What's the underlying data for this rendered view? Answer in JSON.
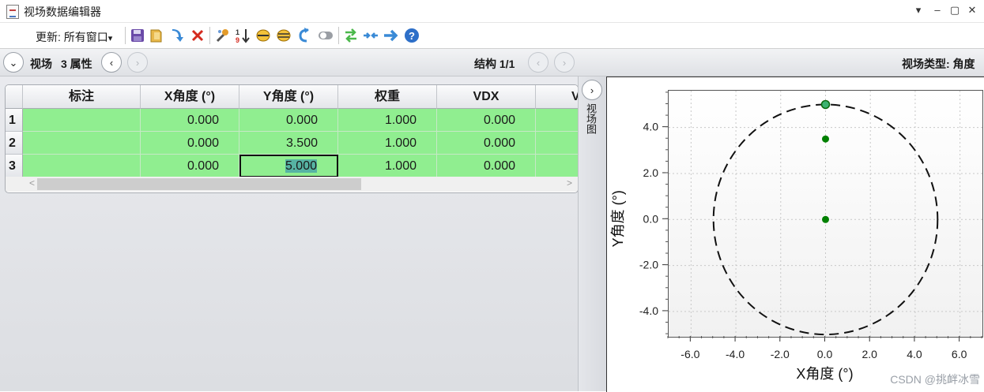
{
  "window": {
    "title": "视场数据编辑器",
    "controls": [
      "▾",
      "–",
      "▢",
      "✕"
    ]
  },
  "toolbar": {
    "update_label": "更新: 所有窗口",
    "update_arrow": "▾",
    "icons": [
      "save-icon",
      "open-icon",
      "import-icon",
      "delete-icon",
      "tool-icon",
      "sort-icon",
      "ellipse-icon",
      "ellipse-fill-icon",
      "reverse-icon",
      "toggle-icon",
      "swap-icon",
      "join-icon",
      "arrow-right-icon",
      "help-icon"
    ]
  },
  "nav": {
    "expand_symbol": "⌄",
    "field_label": "视场",
    "props_label": "3 属性",
    "prev_symbol": "‹",
    "next_symbol": "›",
    "structure_label": "结构 1/1",
    "field_type_label": "视场类型: 角度"
  },
  "table": {
    "columns": [
      "标注",
      "X角度 (°)",
      "Y角度 (°)",
      "权重",
      "VDX",
      "V"
    ],
    "rows": [
      {
        "num": "1",
        "label": "",
        "x": "0.000",
        "y": "0.000",
        "weight": "1.000",
        "vdx": "0.000"
      },
      {
        "num": "2",
        "label": "",
        "x": "0.000",
        "y": "3.500",
        "weight": "1.000",
        "vdx": "0.000"
      },
      {
        "num": "3",
        "label": "",
        "x": "0.000",
        "y": "5.000",
        "weight": "1.000",
        "vdx": "0.000"
      }
    ],
    "scroll_left": "<",
    "scroll_right": ">",
    "row_color": "#90ee90",
    "selection_color": "#56b3a3"
  },
  "side": {
    "collapse_symbol": "›",
    "label": "视场图"
  },
  "chart_data": {
    "type": "scatter",
    "xlabel": "X角度 (°)",
    "ylabel": "Y角度 (°)",
    "xlim": [
      -7,
      7
    ],
    "ylim": [
      -5.1,
      5.6
    ],
    "xticks": [
      -6,
      -4,
      -2,
      0,
      2,
      4,
      6
    ],
    "yticks": [
      -4,
      -2,
      0,
      2,
      4
    ],
    "xtick_labels": [
      "-6.0",
      "-4.0",
      "-2.0",
      "0.0",
      "2.0",
      "4.0",
      "6.0"
    ],
    "ytick_labels": [
      "-4.0",
      "-2.0",
      "0.0",
      "2.0",
      "4.0"
    ],
    "grid": true,
    "points": [
      {
        "x": 0,
        "y": 0,
        "highlighted": false
      },
      {
        "x": 0,
        "y": 3.5,
        "highlighted": false
      },
      {
        "x": 0,
        "y": 5.0,
        "highlighted": true
      }
    ],
    "circle_radius": 5.0,
    "point_color": "#008000",
    "highlight_color": "#3cb371"
  },
  "watermark": "CSDN @挑衅冰雪"
}
